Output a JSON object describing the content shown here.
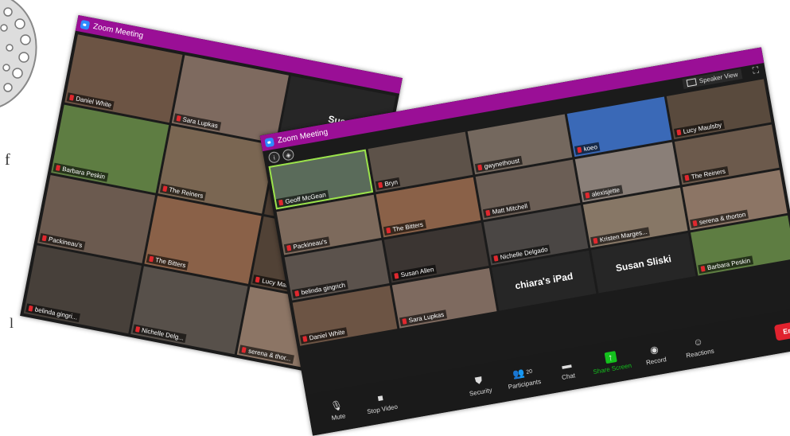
{
  "left_window": {
    "title": "Zoom Meeting",
    "tiles": [
      {
        "name": "Daniel White",
        "color": "#6c5444"
      },
      {
        "name": "Sara Lupkas",
        "color": "#7e6a5f"
      },
      {
        "name": "",
        "big": "Sus",
        "color": "#262626"
      },
      {
        "name": "Barbara Peskin",
        "color": "#5e7d42"
      },
      {
        "name": "The Reiners",
        "color": "#7a6652"
      },
      {
        "name": "",
        "color": "#4a3b30"
      },
      {
        "name": "Packineau's",
        "color": "#6b5a4f"
      },
      {
        "name": "The Bitters",
        "color": "#8a6148"
      },
      {
        "name": "Lucy Maulsby",
        "color": "#514236"
      },
      {
        "name": "belinda gingri...",
        "color": "#47403a"
      },
      {
        "name": "Nichelle Delg...",
        "color": "#57504a"
      },
      {
        "name": "serena & thor...",
        "color": "#8c7565"
      }
    ]
  },
  "right_window": {
    "title": "Zoom Meeting",
    "speaker_view_label": "Speaker View",
    "tiles": [
      {
        "name": "Geoff McGean",
        "color": "#5a6b5a",
        "active": true
      },
      {
        "name": "Bryn",
        "color": "#5d5249"
      },
      {
        "name": "gwynethoust",
        "color": "#74685e"
      },
      {
        "name": "koeo",
        "color": "#3a69b7"
      },
      {
        "name": "Lucy Maulsby",
        "color": "#594a3d"
      },
      {
        "name": "Packineau's",
        "color": "#7d6a5c"
      },
      {
        "name": "The Bitters",
        "color": "#8a6148"
      },
      {
        "name": "Matt Mitchell",
        "color": "#6b5e55"
      },
      {
        "name": "alexisjette",
        "color": "#8a7f78"
      },
      {
        "name": "The Reiners",
        "color": "#6c5a4c"
      },
      {
        "name": "belinda gingrich",
        "color": "#5b524c"
      },
      {
        "name": "Susan Allen",
        "color": "#3b3532"
      },
      {
        "name": "Nichelle Delgado",
        "color": "#4a4644"
      },
      {
        "name": "Kristen Marges...",
        "color": "#877766"
      },
      {
        "name": "serena & thorton",
        "color": "#8c7565"
      },
      {
        "name": "Daniel White",
        "color": "#6c5444"
      },
      {
        "name": "Sara Lupkas",
        "color": "#7e6a5f"
      },
      {
        "name": "",
        "big": "chiara's iPad",
        "color": "#262626"
      },
      {
        "name": "",
        "big": "Susan Sliski",
        "color": "#262626"
      },
      {
        "name": "Barbara Peskin",
        "color": "#5e7d42"
      }
    ],
    "toolbar": {
      "mute": "Mute",
      "stop_video": "Stop Video",
      "security": "Security",
      "participants": "Participants",
      "participant_count": "20",
      "chat": "Chat",
      "share_screen": "Share Screen",
      "record": "Record",
      "reactions": "Reactions",
      "end": "End"
    }
  }
}
